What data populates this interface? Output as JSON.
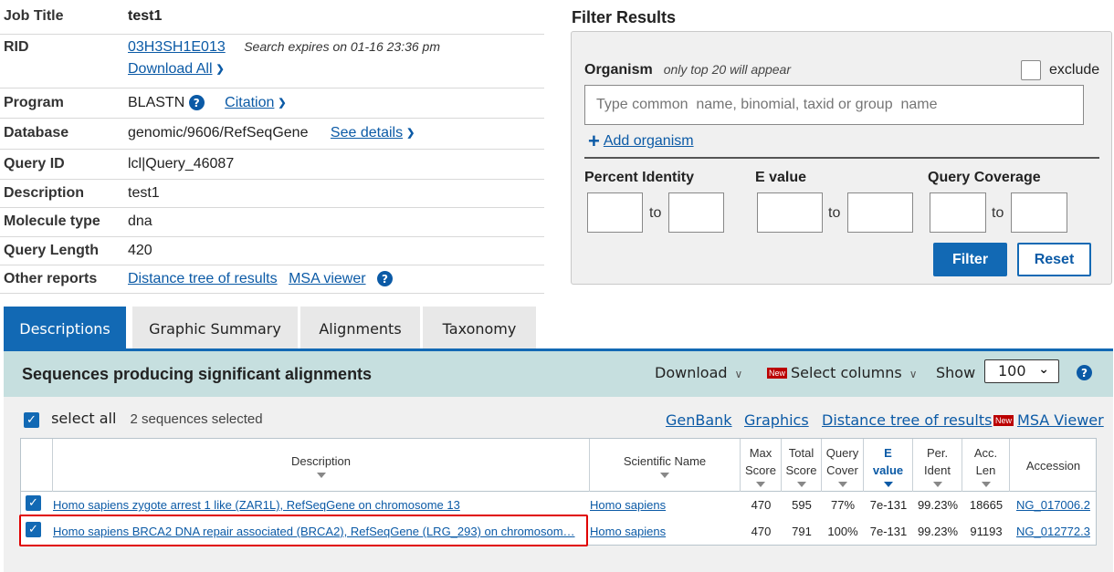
{
  "summary": {
    "job_title_label": "Job Title",
    "job_title": "test1",
    "rid_label": "RID",
    "rid": "03H3SH1E013",
    "expires": "Search expires on 01-16 23:36 pm",
    "download_all": "Download All",
    "program_label": "Program",
    "program": "BLASTN",
    "citation": "Citation",
    "database_label": "Database",
    "database": "genomic/9606/RefSeqGene",
    "see_details": "See details",
    "query_id_label": "Query ID",
    "query_id": "lcl|Query_46087",
    "description_label": "Description",
    "description": "test1",
    "molecule_type_label": "Molecule type",
    "molecule_type": "dna",
    "query_length_label": "Query Length",
    "query_length": "420",
    "other_reports_label": "Other reports",
    "distance_tree": "Distance tree of results",
    "msa_viewer": "MSA viewer"
  },
  "filter": {
    "title": "Filter Results",
    "organism_label": "Organism",
    "organism_note": "only top 20 will appear",
    "exclude_label": "exclude",
    "organism_placeholder": "Type common  name, binomial, taxid or group  name",
    "add_organism": "Add organism",
    "percent_identity_label": "Percent Identity",
    "evalue_label": "E value",
    "query_coverage_label": "Query Coverage",
    "to_label": "to",
    "filter_button": "Filter",
    "reset_button": "Reset"
  },
  "tabs": [
    "Descriptions",
    "Graphic Summary",
    "Alignments",
    "Taxonomy"
  ],
  "results": {
    "title": "Sequences producing significant alignments",
    "download": "Download",
    "new_badge": "New",
    "select_columns": "Select columns",
    "show_label": "Show",
    "show_value": "100",
    "select_all": "select all",
    "selected_count": "2 sequences selected",
    "links": {
      "genbank": "GenBank",
      "graphics": "Graphics",
      "distance_tree": "Distance tree of results",
      "msa_viewer": "MSA Viewer"
    },
    "columns": {
      "description": "Description",
      "scientific_name": "Scientific Name",
      "max_score_1": "Max",
      "max_score_2": "Score",
      "total_score_1": "Total",
      "total_score_2": "Score",
      "query_cover_1": "Query",
      "query_cover_2": "Cover",
      "evalue_1": "E",
      "evalue_2": "value",
      "per_ident_1": "Per.",
      "per_ident_2": "Ident",
      "acc_len_1": "Acc.",
      "acc_len_2": "Len",
      "accession": "Accession"
    },
    "rows": [
      {
        "description": "Homo sapiens zygote arrest 1 like (ZAR1L), RefSeqGene on chromosome 13",
        "scientific_name": "Homo sapiens",
        "max_score": "470",
        "total_score": "595",
        "query_cover": "77%",
        "evalue": "7e-131",
        "per_ident": "99.23%",
        "acc_len": "18665",
        "accession": "NG_017006.2"
      },
      {
        "description": "Homo sapiens BRCA2 DNA repair associated (BRCA2), RefSeqGene (LRG_293) on chromosom…",
        "scientific_name": "Homo sapiens",
        "max_score": "470",
        "total_score": "791",
        "query_cover": "100%",
        "evalue": "7e-131",
        "per_ident": "99.23%",
        "acc_len": "91193",
        "accession": "NG_012772.3"
      }
    ]
  },
  "colors": {
    "accent": "#1269b4",
    "link": "#0b5aa6",
    "results_header_bg": "#c6dfdf",
    "highlight": "#e00000"
  }
}
